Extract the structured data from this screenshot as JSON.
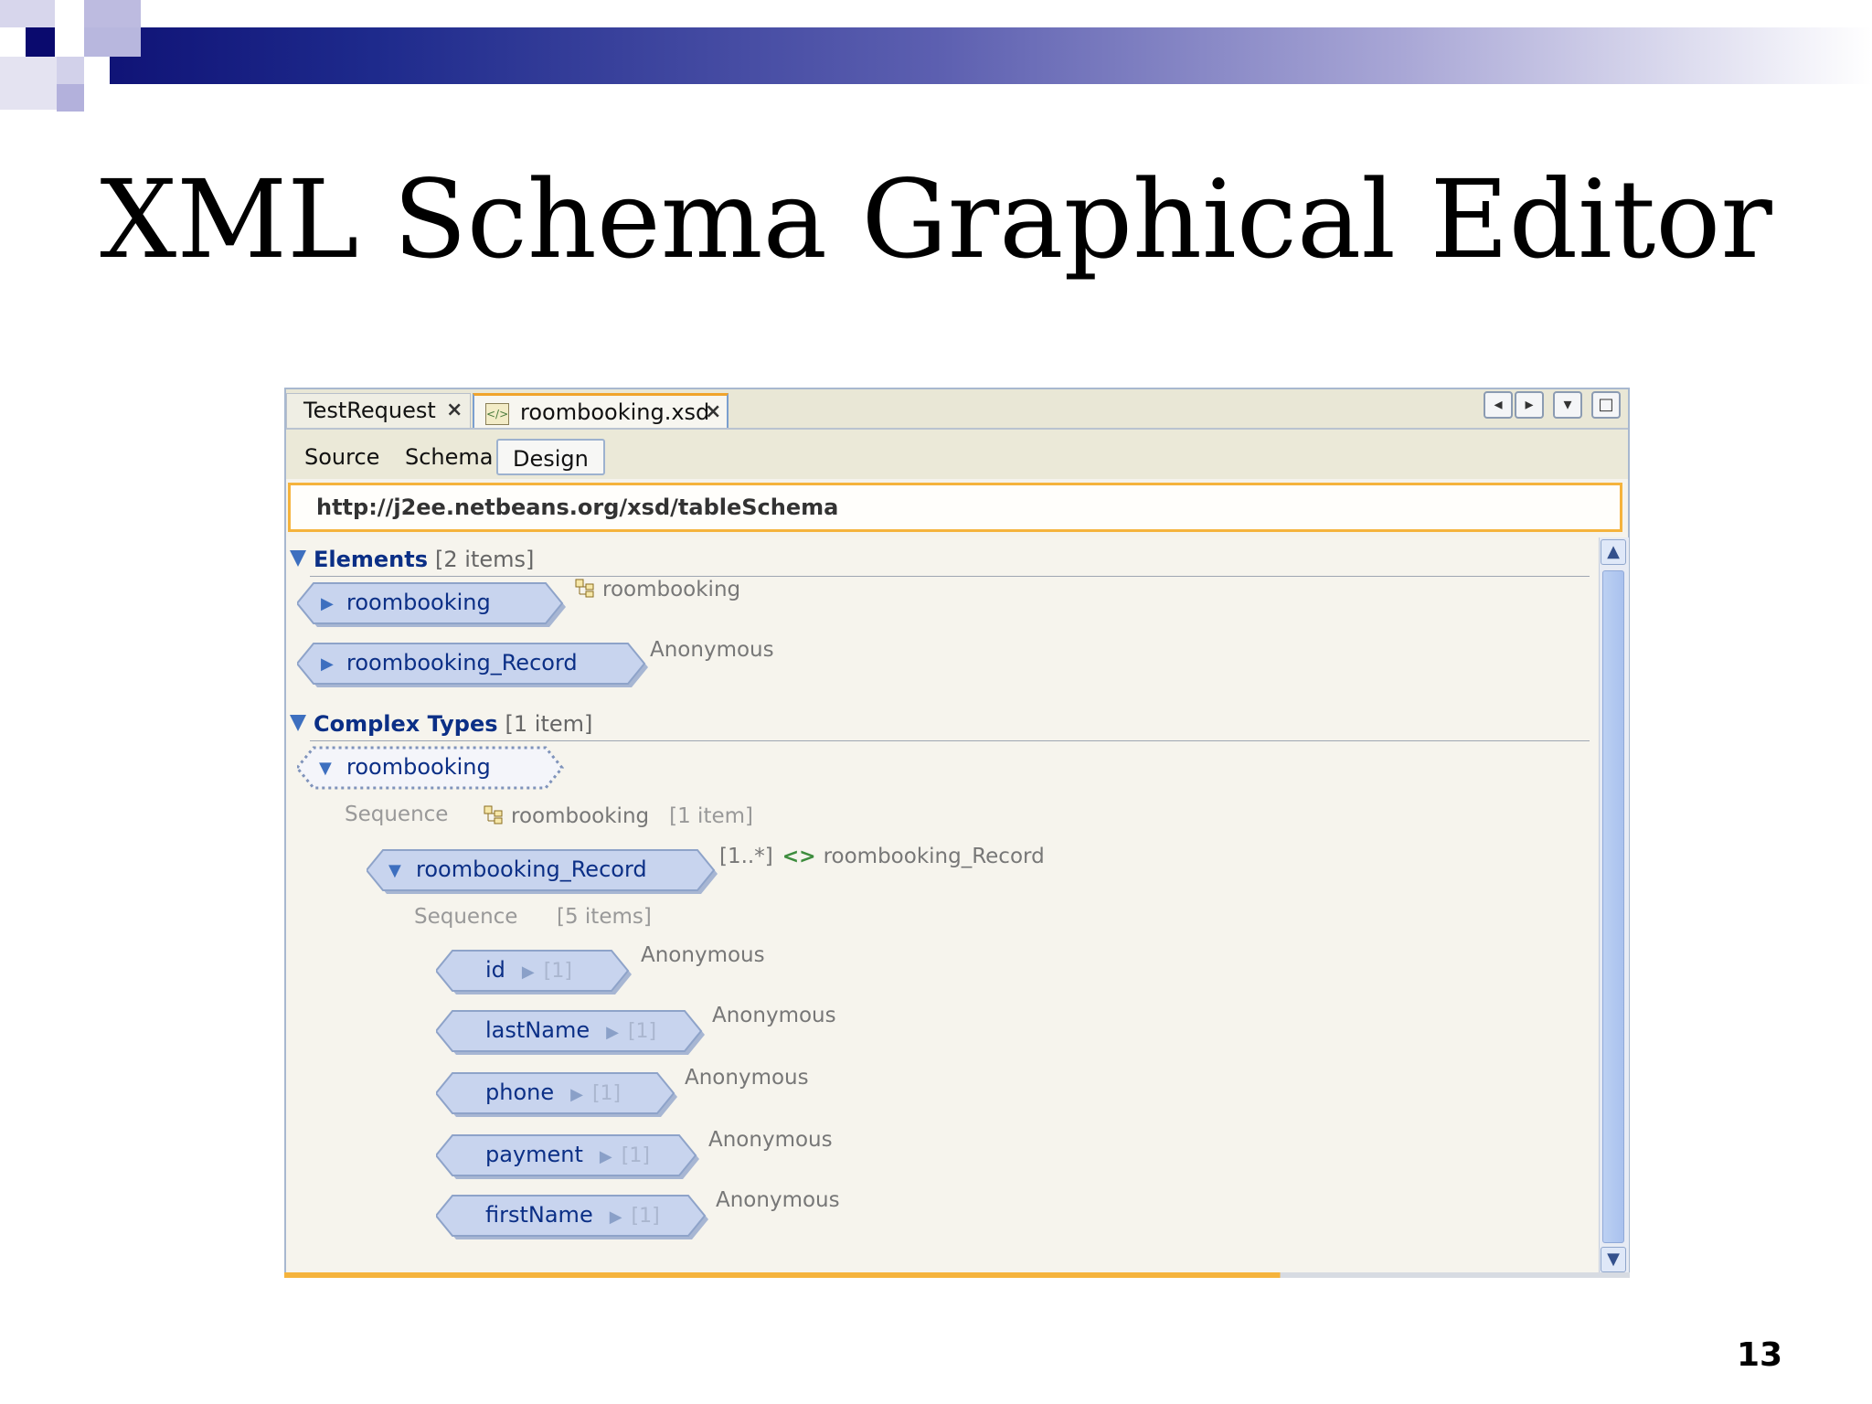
{
  "slide": {
    "title": "XML Schema Graphical Editor",
    "page_number": "13"
  },
  "tabs": [
    {
      "label": "TestRequest",
      "close": "×"
    },
    {
      "label": "roombooking.xsd",
      "close": "×",
      "icon": "xsd-file-icon",
      "active": true
    }
  ],
  "window_controls": {
    "left": "◂",
    "right": "▸",
    "menu": "▾",
    "maximize": "□"
  },
  "view_tabs": {
    "source": "Source",
    "schema": "Schema",
    "design": "Design",
    "active": "Design"
  },
  "namespace": "http://j2ee.netbeans.org/xsd/tableSchema",
  "elements_section": {
    "title": "Elements",
    "count": "[2 items]",
    "items": [
      {
        "label": "roombooking",
        "type": "roombooking"
      },
      {
        "label": "roombooking_Record",
        "type": "Anonymous"
      }
    ]
  },
  "complex_types_section": {
    "title": "Complex Types",
    "count": "[1 item]",
    "type_name": "roombooking",
    "sequence1": {
      "label": "Sequence",
      "name": "roombooking",
      "count": "[1 item]"
    },
    "record": {
      "label": "roombooking_Record",
      "multiplicity": "[1..*]",
      "ref": "roombooking_Record"
    },
    "sequence2": {
      "label": "Sequence",
      "count": "[5 items]"
    },
    "fields": [
      {
        "label": "id",
        "occ": "[1]",
        "type": "Anonymous"
      },
      {
        "label": "lastName",
        "occ": "[1]",
        "type": "Anonymous"
      },
      {
        "label": "phone",
        "occ": "[1]",
        "type": "Anonymous"
      },
      {
        "label": "payment",
        "occ": "[1]",
        "type": "Anonymous"
      },
      {
        "label": "firstName",
        "occ": "[1]",
        "type": "Anonymous"
      }
    ]
  },
  "scrollbar": {
    "up": "▲",
    "down": "▼"
  },
  "colors": {
    "accent_orange": "#f5b33c",
    "node_fill": "#c6d3ee",
    "node_text": "#0b2f86",
    "header_dark": "#0a0a6e"
  }
}
